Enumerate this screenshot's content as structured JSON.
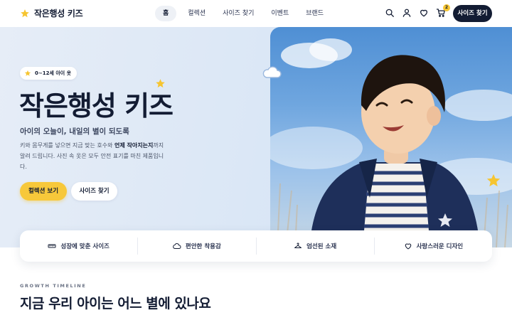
{
  "header": {
    "logo_text": "작은행성 키즈",
    "nav": [
      {
        "label": "홈",
        "active": true
      },
      {
        "label": "컬렉션",
        "active": false
      },
      {
        "label": "사이즈 찾기",
        "active": false
      },
      {
        "label": "이벤트",
        "active": false
      },
      {
        "label": "브랜드",
        "active": false
      }
    ],
    "icons": [
      "search-icon",
      "user-icon",
      "heart-icon",
      "cart-icon"
    ],
    "cart_count": "2",
    "cta_label": "사이즈 찾기"
  },
  "hero": {
    "badge": "0~12세 아이 옷",
    "title": "작은행성 키즈",
    "subtitle": "아이의 오늘이, 내일의 별이 되도록",
    "desc_before": "키와 몸무게를 넣으면 지금 맞는 호수와 ",
    "desc_bold": "언제 작아지는지",
    "desc_after": "까지 알려 드립니다. 사진 속 옷은 모두 안전 표기를 마친 제품입니다.",
    "primary_button": "컬렉션 보기",
    "secondary_button": "사이즈 찾기"
  },
  "features": [
    {
      "label": "성장에 맞춘 사이즈",
      "icon": "ruler-icon"
    },
    {
      "label": "편안한 착용감",
      "icon": "cloud-icon"
    },
    {
      "label": "엄선된 소재",
      "icon": "hanger-icon"
    },
    {
      "label": "사랑스러운 디자인",
      "icon": "heart-icon"
    }
  ],
  "timeline": {
    "eyebrow": "GROWTH TIMELINE",
    "title": "지금 우리 아이는 어느 별에 있나요"
  },
  "colors": {
    "navy": "#131c33",
    "accent_yellow": "#f7c83a",
    "hero_bg": "#dde8f6"
  }
}
